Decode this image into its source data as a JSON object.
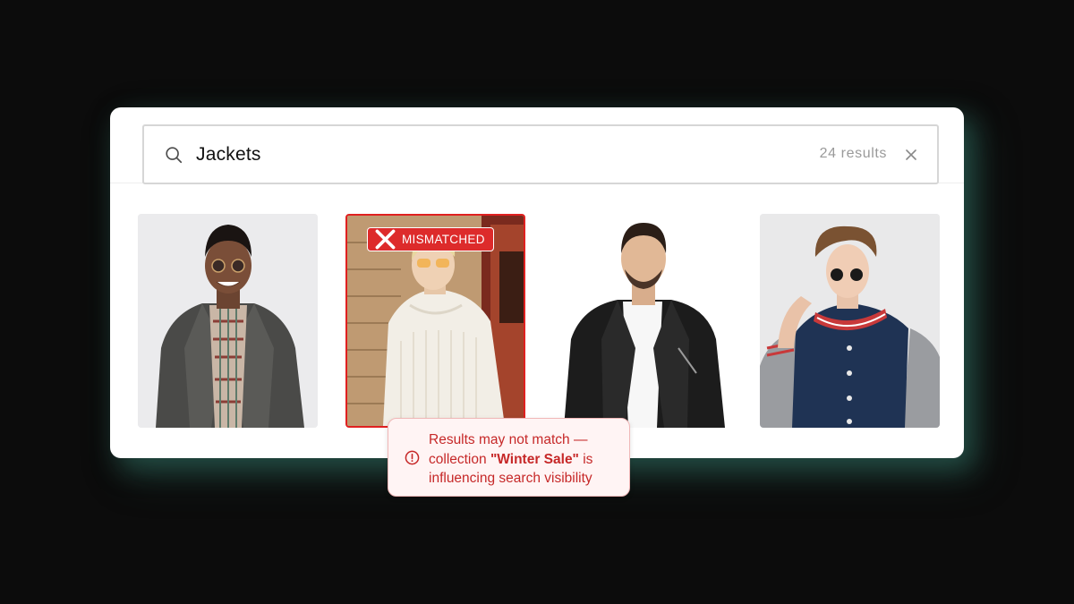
{
  "search": {
    "query": "Jackets",
    "placeholder": "",
    "result_count": "24 results",
    "icon": "search-icon",
    "clear_icon": "close-icon"
  },
  "products": [
    {
      "id": "tile-1",
      "description": "man in grey leather jacket and plaid shirt",
      "flag": null
    },
    {
      "id": "tile-2",
      "description": "man in cream knit sweater",
      "flag": "MISMATCHED"
    },
    {
      "id": "tile-3",
      "description": "man in black leather jacket",
      "flag": null
    },
    {
      "id": "tile-4",
      "description": "man in navy varsity jacket",
      "flag": null
    }
  ],
  "badge": {
    "label": "MISMATCHED",
    "icon": "close-icon"
  },
  "warning": {
    "line1": "Results may not match —",
    "prefix": "collection ",
    "collection": "\"Winter Sale\"",
    "suffix": " is",
    "line3": "influencing search visibility",
    "icon": "alert-circle-icon"
  },
  "colors": {
    "background": "#0c0c0c",
    "card": "#ffffff",
    "accent_error": "#dd2b2b",
    "warning_bg": "#fff4f4",
    "warning_text": "#c62828",
    "glow": "#306e60"
  }
}
